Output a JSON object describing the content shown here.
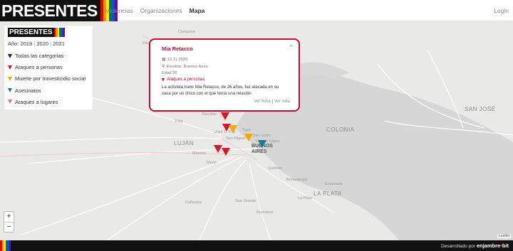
{
  "brand": {
    "name": "PRESENTES",
    "rainbow": [
      "#e40303",
      "#ff8c00",
      "#ffed00",
      "#008026",
      "#004dff",
      "#750787"
    ]
  },
  "nav": {
    "items": [
      {
        "label": "Violencias"
      },
      {
        "label": "Organizaciones"
      },
      {
        "label": "Mapa"
      }
    ],
    "login": "Login"
  },
  "filters": {
    "year_label": "Año:",
    "years": [
      "2019",
      "2020",
      "2021"
    ],
    "sep": "|",
    "categories": [
      {
        "label": "Todas las categorias",
        "color": "#222222"
      },
      {
        "label": "Ataques a personas",
        "color": "#d01c2a"
      },
      {
        "label": "Muerte por travesticidio social",
        "color": "#f2a900"
      },
      {
        "label": "Asesinatos",
        "color": "#1a7a96"
      },
      {
        "label": "Ataques a lugares",
        "color": "#e86a8a"
      }
    ]
  },
  "popup": {
    "close": "×",
    "title": "Mia Retacco",
    "date": "10.11.2020",
    "location": "Escobar, Buenos Aires",
    "age": "Edad 26",
    "category": "Ataques a personas",
    "description": "La activista trans Mia Retacco, de 26 años, fue atacada en su casa por un chico con el que tenía una relación",
    "link_ficha": "Ver ficha",
    "link_sep": "|",
    "link_nota": "Ver nota"
  },
  "map": {
    "places": [
      {
        "text": "Campana"
      },
      {
        "text": "Zárate"
      },
      {
        "text": "Escobar"
      },
      {
        "text": "Pilar"
      },
      {
        "text": "José C. Paz"
      },
      {
        "text": "San Miguel"
      },
      {
        "text": "Tigre"
      },
      {
        "text": "San Isidro"
      },
      {
        "text": "Vicente López"
      },
      {
        "text": "LUJÁN"
      },
      {
        "text": "BUENOS AIRES"
      },
      {
        "text": "LA PLATA"
      },
      {
        "text": "SAN JOSÉ"
      },
      {
        "text": "COLONIA"
      },
      {
        "text": "Quilmes"
      },
      {
        "text": "Moreno"
      },
      {
        "text": "Merlo"
      },
      {
        "text": "La Plata"
      },
      {
        "text": "Berazategui"
      },
      {
        "text": "Ensenada"
      },
      {
        "text": "Cañuelas"
      },
      {
        "text": "San Vicente"
      },
      {
        "text": "Brandsen"
      }
    ],
    "zoom_in": "+",
    "zoom_out": "−",
    "attribution": "Leaflet"
  },
  "footer": {
    "credit": "Desarrollado por",
    "logo": "enjambre",
    "logo_suffix": "bit"
  }
}
